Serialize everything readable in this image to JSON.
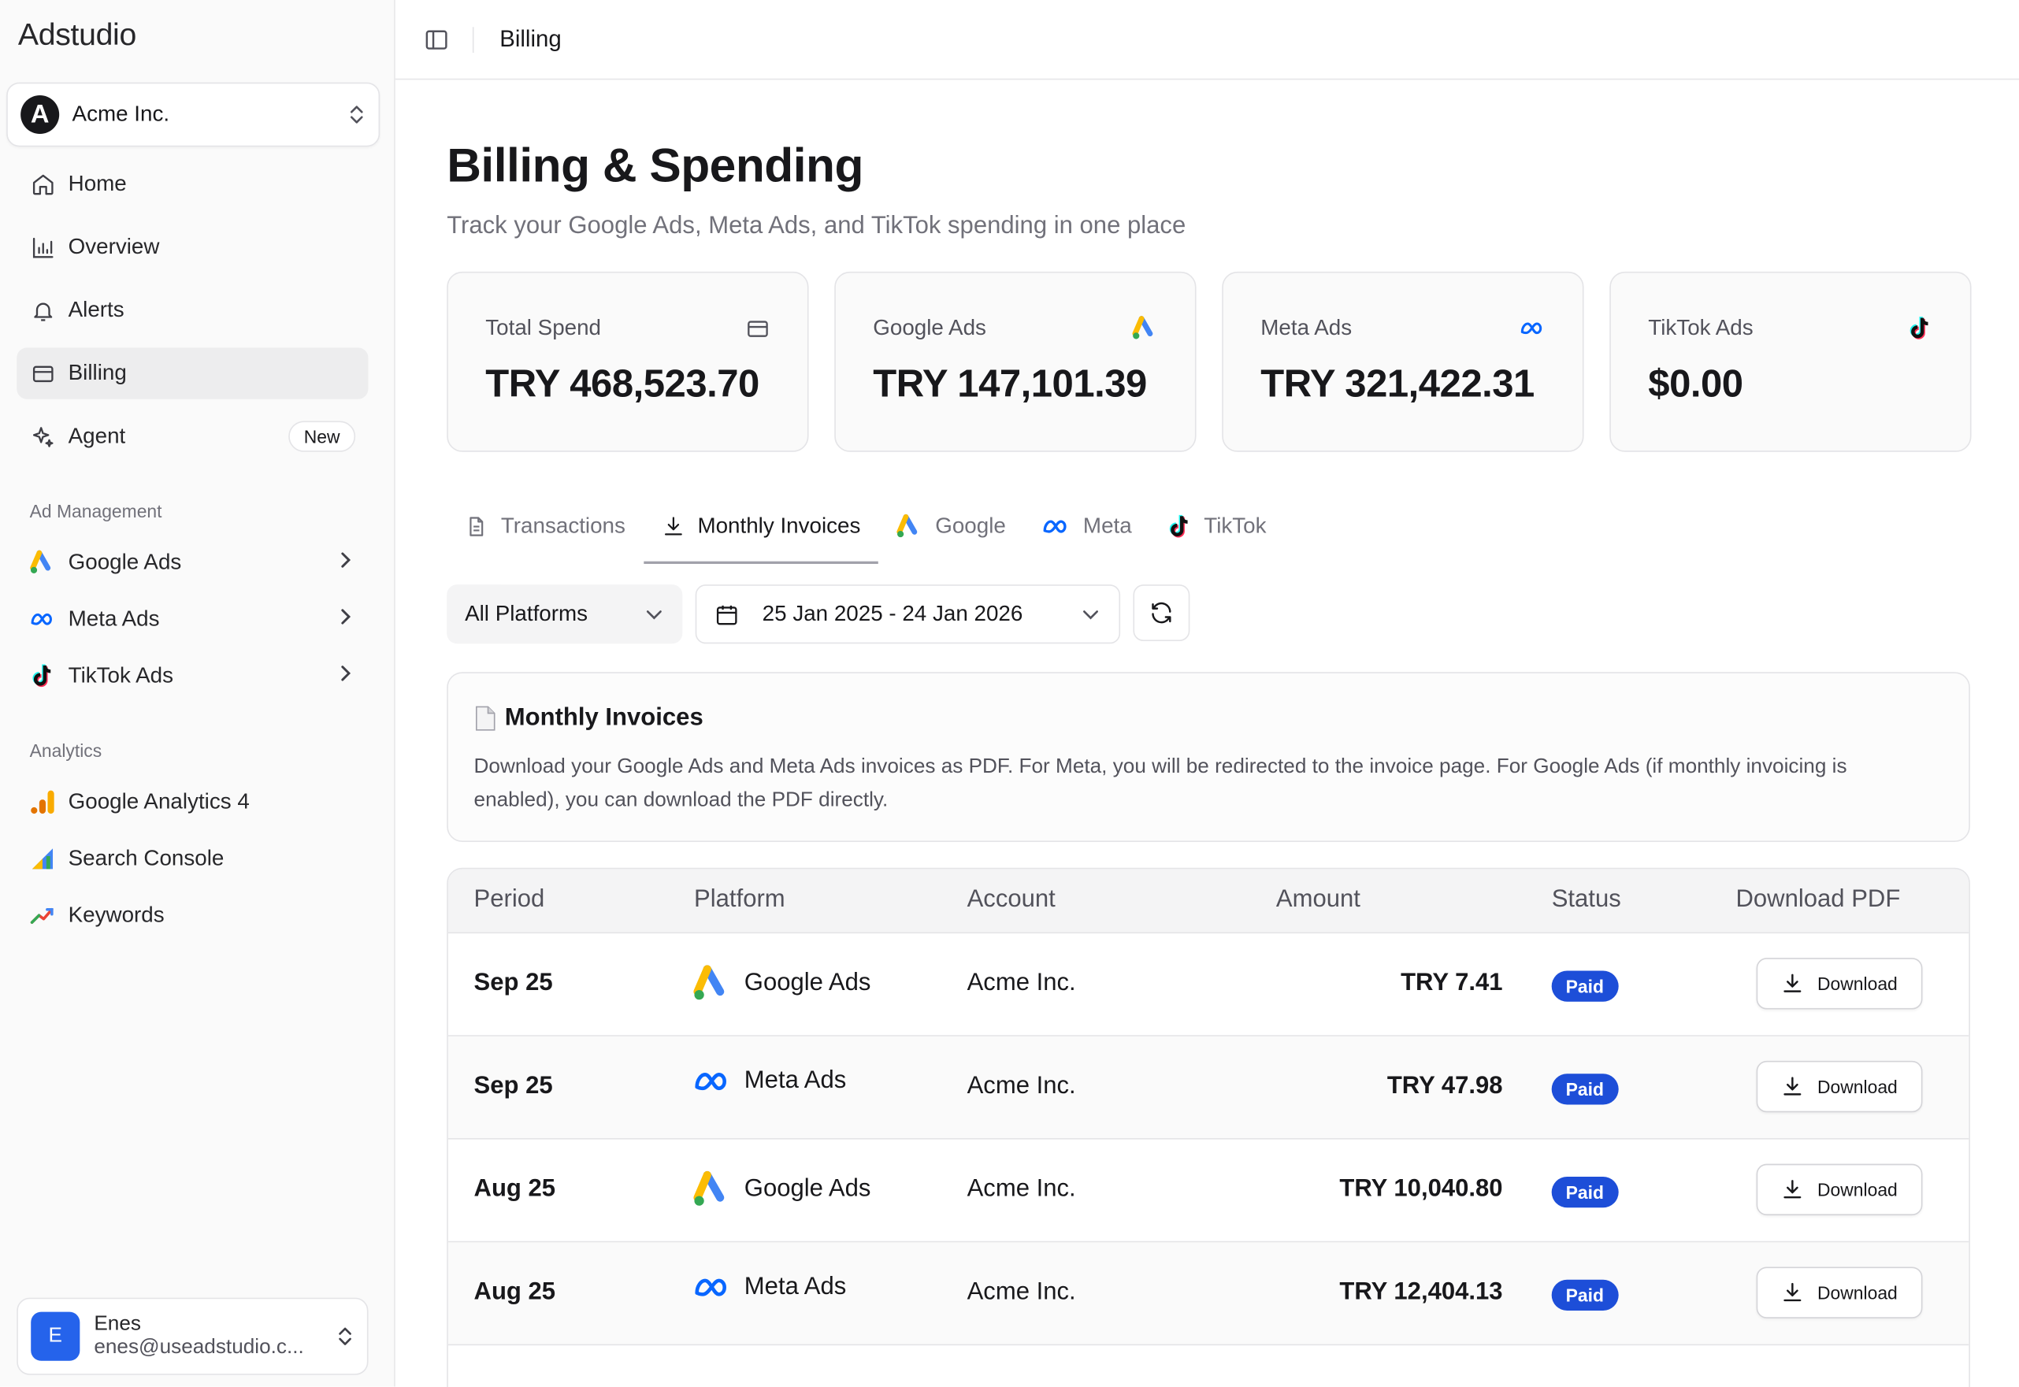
{
  "app": {
    "brand": "Adstudio"
  },
  "org": {
    "name": "Acme Inc.",
    "logo_letter": "A"
  },
  "sidebar": {
    "items": [
      {
        "label": "Home",
        "icon": "home-icon"
      },
      {
        "label": "Overview",
        "icon": "bar-chart-icon"
      },
      {
        "label": "Alerts",
        "icon": "bell-icon"
      },
      {
        "label": "Billing",
        "icon": "credit-card-icon",
        "active": true
      },
      {
        "label": "Agent",
        "icon": "sparkle-icon",
        "badge": "New"
      }
    ],
    "section_ad": "Ad Management",
    "ad_items": [
      {
        "label": "Google Ads",
        "icon": "google-ads-icon"
      },
      {
        "label": "Meta Ads",
        "icon": "meta-icon"
      },
      {
        "label": "TikTok Ads",
        "icon": "tiktok-icon"
      }
    ],
    "section_analytics": "Analytics",
    "analytics_items": [
      {
        "label": "Google Analytics 4",
        "icon": "google-analytics-icon"
      },
      {
        "label": "Search Console",
        "icon": "search-console-icon"
      },
      {
        "label": "Keywords",
        "icon": "trend-icon"
      }
    ]
  },
  "user": {
    "initial": "E",
    "name": "Enes",
    "email": "enes@useadstudio.c..."
  },
  "header": {
    "breadcrumb": "Billing"
  },
  "page": {
    "title": "Billing & Spending",
    "subtitle": "Track your Google Ads, Meta Ads, and TikTok spending in one place"
  },
  "cards": [
    {
      "label": "Total Spend",
      "value": "TRY 468,523.70",
      "icon": "credit-card-icon"
    },
    {
      "label": "Google Ads",
      "value": "TRY 147,101.39",
      "icon": "google-ads-icon"
    },
    {
      "label": "Meta Ads",
      "value": "TRY 321,422.31",
      "icon": "meta-icon"
    },
    {
      "label": "TikTok Ads",
      "value": "$0.00",
      "icon": "tiktok-icon"
    }
  ],
  "tabs": [
    {
      "label": "Transactions",
      "icon": "file-text-icon"
    },
    {
      "label": "Monthly Invoices",
      "icon": "download-icon",
      "active": true
    },
    {
      "label": "Google",
      "icon": "google-ads-icon"
    },
    {
      "label": "Meta",
      "icon": "meta-icon"
    },
    {
      "label": "TikTok",
      "icon": "tiktok-icon"
    }
  ],
  "filters": {
    "platform": "All Platforms",
    "date_range": "25 Jan 2025 - 24 Jan 2026"
  },
  "info": {
    "title": "Monthly Invoices",
    "text": "Download your Google Ads and Meta Ads invoices as PDF. For Meta, you will be redirected to the invoice page. For Google Ads (if monthly invoicing is enabled), you can download the PDF directly."
  },
  "table": {
    "headers": {
      "period": "Period",
      "platform": "Platform",
      "account": "Account",
      "amount": "Amount",
      "status": "Status",
      "download": "Download PDF"
    },
    "rows": [
      {
        "period": "Sep 25",
        "platform": "Google Ads",
        "account": "Acme Inc.",
        "amount": "TRY 7.41",
        "status": "Paid",
        "action": "Download"
      },
      {
        "period": "Sep 25",
        "platform": "Meta Ads",
        "account": "Acme Inc.",
        "amount": "TRY 47.98",
        "status": "Paid",
        "action": "Download"
      },
      {
        "period": "Aug 25",
        "platform": "Google Ads",
        "account": "Acme Inc.",
        "amount": "TRY 10,040.80",
        "status": "Paid",
        "action": "Download"
      },
      {
        "period": "Aug 25",
        "platform": "Meta Ads",
        "account": "Acme Inc.",
        "amount": "TRY 12,404.13",
        "status": "Paid",
        "action": "Download"
      }
    ]
  },
  "colors": {
    "accent_blue": "#1d4ed8",
    "avatar_blue": "#2563eb",
    "meta_blue": "#0866ff"
  }
}
